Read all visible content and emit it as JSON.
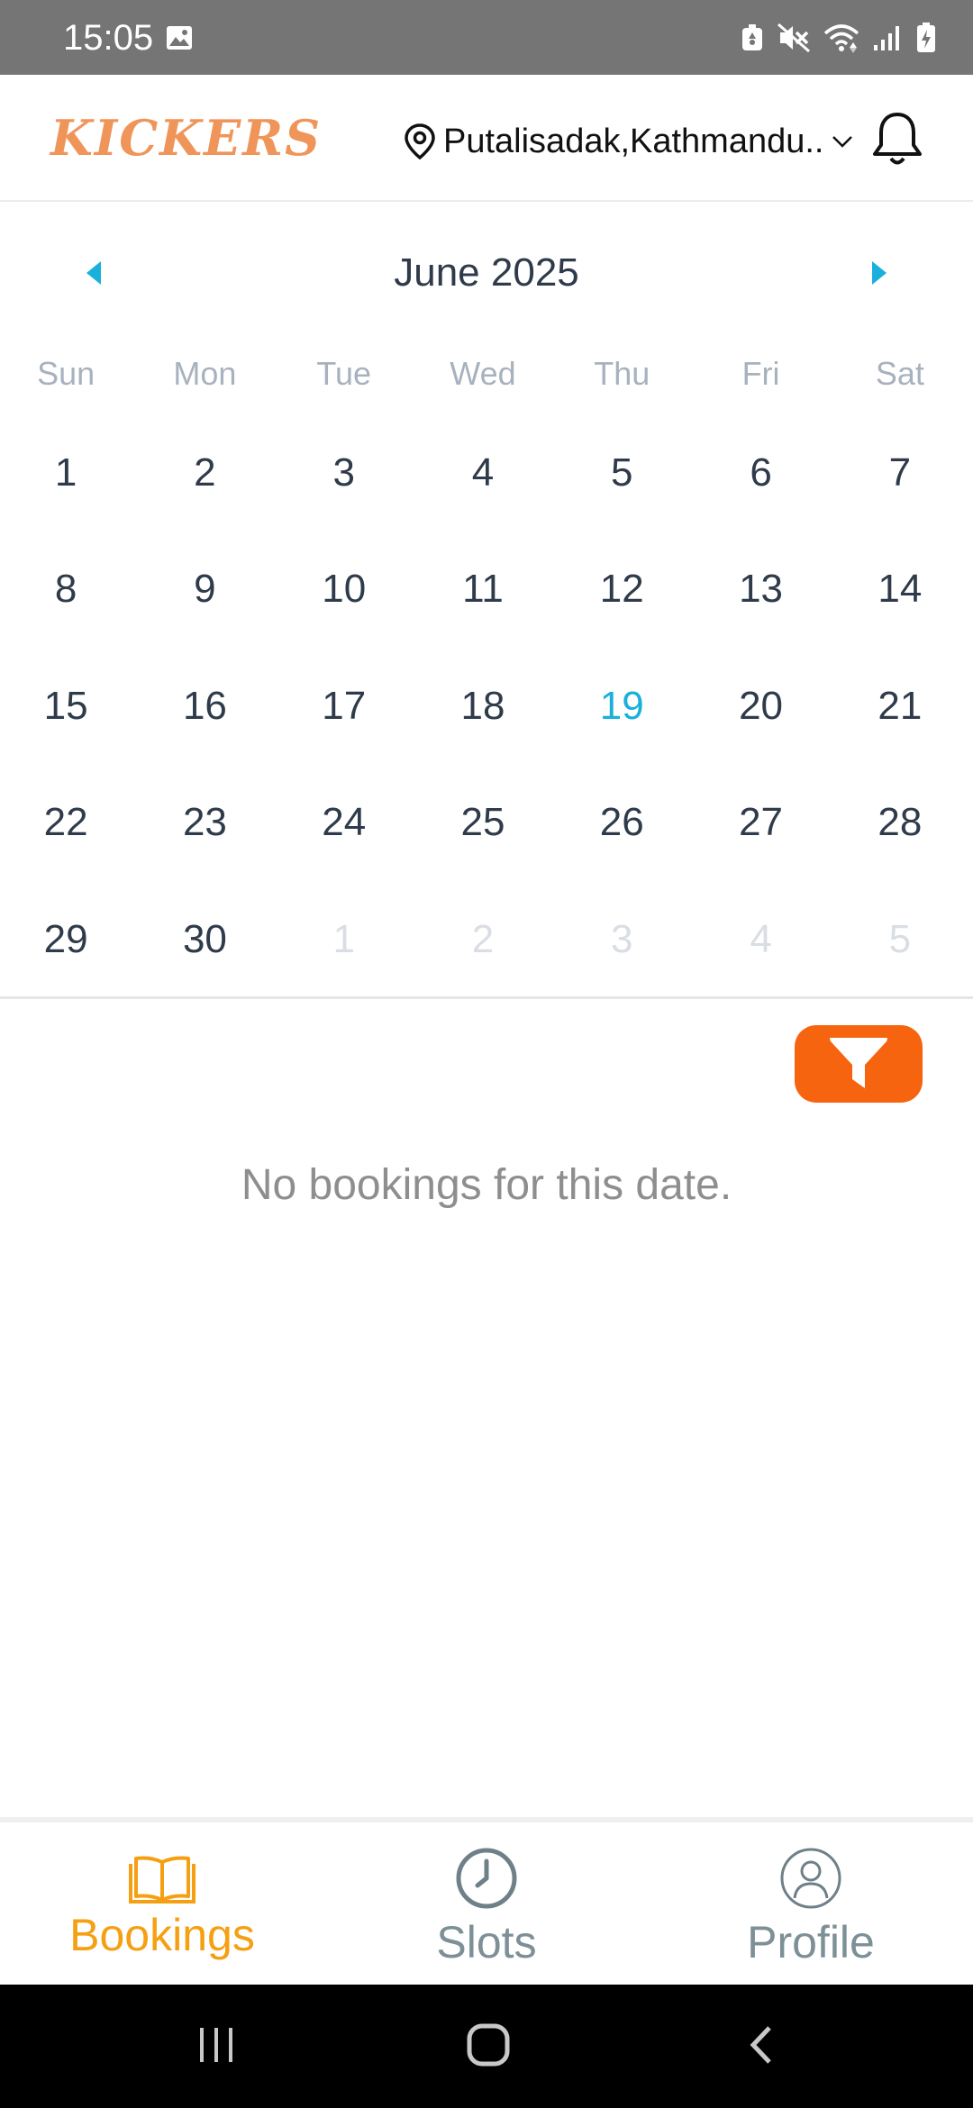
{
  "status_bar": {
    "time": "15:05",
    "icons": [
      "gallery-icon",
      "battery-saver-icon",
      "mute-icon",
      "wifi-icon",
      "signal-icon",
      "battery-icon"
    ]
  },
  "header": {
    "logo": "KICKERS",
    "location": "Putalisadak,Kathmandu..",
    "icons": [
      "location-pin-icon",
      "chevron-down-icon",
      "bell-icon"
    ]
  },
  "calendar": {
    "month": "June 2025",
    "weekdays": [
      "Sun",
      "Mon",
      "Tue",
      "Wed",
      "Thu",
      "Fri",
      "Sat"
    ],
    "selected_day": "19",
    "accent": "#1ab0dc",
    "weeks": [
      [
        "1",
        "2",
        "3",
        "4",
        "5",
        "6",
        "7"
      ],
      [
        "8",
        "9",
        "10",
        "11",
        "12",
        "13",
        "14"
      ],
      [
        "15",
        "16",
        "17",
        "18",
        "19",
        "20",
        "21"
      ],
      [
        "22",
        "23",
        "24",
        "25",
        "26",
        "27",
        "28"
      ],
      [
        "29",
        "30",
        "1",
        "2",
        "3",
        "4",
        "5"
      ]
    ]
  },
  "main": {
    "filter_color": "#f7640f",
    "empty_message": "No bookings for this date."
  },
  "bottom_nav": {
    "active_color": "#f5a012",
    "items": [
      {
        "label": "Bookings",
        "icon": "book-icon"
      },
      {
        "label": "Slots",
        "icon": "clock-icon"
      },
      {
        "label": "Profile",
        "icon": "user-icon"
      }
    ]
  }
}
